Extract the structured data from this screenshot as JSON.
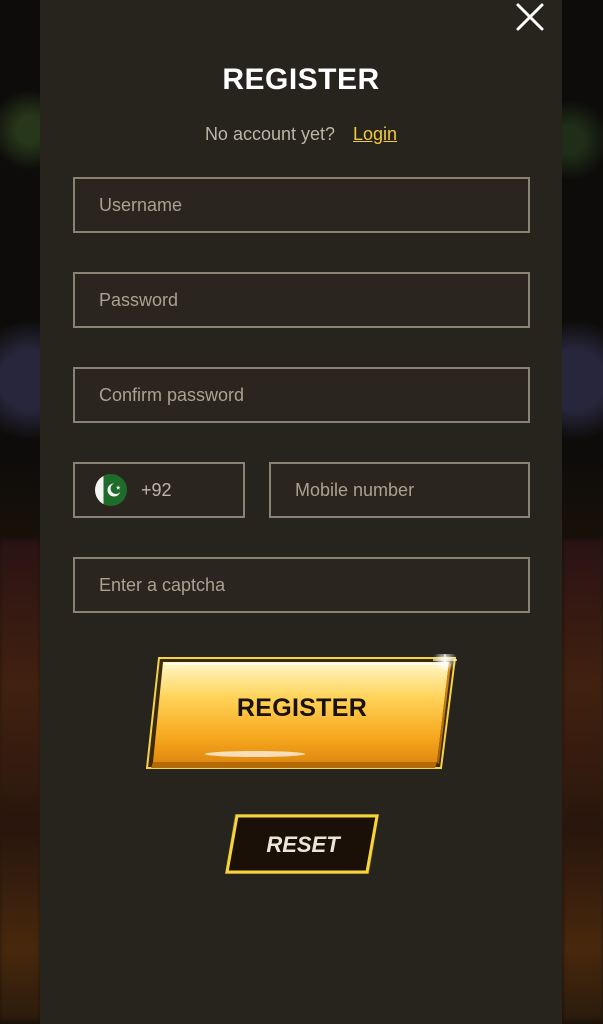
{
  "modal": {
    "title": "REGISTER",
    "no_account_text": "No account yet?",
    "login_link": "Login",
    "close_icon": "close-icon"
  },
  "form": {
    "username_placeholder": "Username",
    "password_placeholder": "Password",
    "confirm_password_placeholder": "Confirm password",
    "country_code": "+92",
    "country_flag_icon": "pakistan-flag-icon",
    "mobile_placeholder": "Mobile number",
    "captcha_placeholder": "Enter a captcha"
  },
  "buttons": {
    "register_label": "REGISTER",
    "reset_label": "RESET"
  },
  "colors": {
    "modal_bg": "#27231d",
    "accent_gold": "#f2cc3e",
    "field_border": "#8a8374",
    "text_muted": "#bdb6a6"
  }
}
